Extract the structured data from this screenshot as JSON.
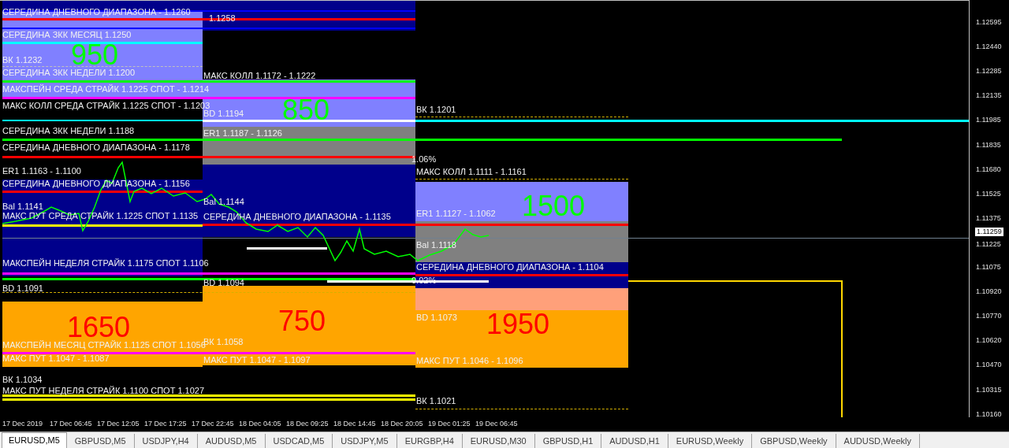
{
  "chart": {
    "labels": [
      {
        "text": "СЕРЕДИНА ДНЕВНОГО ДИАПАЗОНА - 1.1260"
      },
      {
        "text": "СЕРЕДИНА ЗКК МЕСЯЦ 1.1250"
      },
      {
        "text": "ВК 1.1232"
      },
      {
        "text": "СЕРЕДИНА ЗКК НЕДЕЛИ 1.1200"
      },
      {
        "text": "МАКСПЕЙН СРЕДА  СТРАЙК 1.1225 СПОТ - 1.1214"
      },
      {
        "text": "МАКС КОЛЛ СРЕДА  СТРАЙК 1.1225 СПОТ - 1.1203"
      },
      {
        "text": "СЕРЕДИНА ЗКК НЕДЕЛИ 1.1188"
      },
      {
        "text": "СЕРЕДИНА ДНЕВНОГО ДИАПАЗОНА - 1.1178"
      },
      {
        "text": "ER1 1.1163 - 1.1100"
      },
      {
        "text": "СЕРЕДИНА ДНЕВНОГО ДИАПАЗОНА - 1.1156"
      },
      {
        "text": "Bal 1.1141"
      },
      {
        "text": "МАКС ПУТ СРЕДА  СТРАЙК 1.1225 СПОТ 1.1135"
      },
      {
        "text": "МАКСПЕЙН НЕДЕЛЯ  СТРАЙК 1.1175 СПОТ  1.1106"
      },
      {
        "text": "BD 1.1091"
      },
      {
        "text": "МАКСПЕЙН МЕСЯЦ  СТРАЙК 1.1125 СПОТ  1.1056"
      },
      {
        "text": "МАКС ПУТ 1.1047 - 1.1087"
      },
      {
        "text": "ВК 1.1034"
      },
      {
        "text": "МАКС ПУТ НЕДЕЛЯ СТРАЙК 1.1100 СПОТ 1.1027"
      },
      {
        "text": "1.1258"
      },
      {
        "text": "МАКС КОЛЛ 1.1172 - 1.1222"
      },
      {
        "text": "BD 1.1194"
      },
      {
        "text": "ER1 1.1187 - 1.1126"
      },
      {
        "text": "Bal 1.1144"
      },
      {
        "text": "СЕРЕДИНА ДНЕВНОГО ДИАПАЗОНА - 1.1135"
      },
      {
        "text": "BD 1.1094"
      },
      {
        "text": "ВК 1.1058"
      },
      {
        "text": "МАКС ПУТ 1.1047 - 1.1097"
      },
      {
        "text": "ВК 1.1201"
      },
      {
        "text": "1.06%"
      },
      {
        "text": "МАКС КОЛЛ 1.1111 - 1.1161"
      },
      {
        "text": "ER1 1.1127 - 1.1062"
      },
      {
        "text": "Bal 1.1118"
      },
      {
        "text": "СЕРЕДИНА ДНЕВНОГО ДИАПАЗОНА - 1.1104"
      },
      {
        "text": "0.02%"
      },
      {
        "text": "BD 1.1073"
      },
      {
        "text": "МАКС ПУТ 1.1046 - 1.1096"
      },
      {
        "text": "ВК 1.1021"
      }
    ],
    "big_numbers": [
      {
        "text": "950",
        "color": "#00ff00"
      },
      {
        "text": "850",
        "color": "#00ff00"
      },
      {
        "text": "1500",
        "color": "#00ff00"
      },
      {
        "text": "1650",
        "color": "#ff0000"
      },
      {
        "text": "750",
        "color": "#ff0000"
      },
      {
        "text": "1950",
        "color": "#ff0000"
      }
    ]
  },
  "price_axis": [
    "1.12595",
    "1.12440",
    "1.12285",
    "1.12135",
    "1.11985",
    "1.11835",
    "1.11680",
    "1.11525",
    "1.11375",
    "1.11225",
    "1.11075",
    "1.10920",
    "1.10770",
    "1.10620",
    "1.10470",
    "1.10315",
    "1.10160"
  ],
  "current_price": "1.11259",
  "time_axis": [
    "17 Dec 2019",
    "17 Dec 06:45",
    "17 Dec 12:05",
    "17 Dec 17:25",
    "17 Dec 22:45",
    "18 Dec 04:05",
    "18 Dec 09:25",
    "18 Dec 14:45",
    "18 Dec 20:05",
    "19 Dec 01:25",
    "19 Dec 06:45"
  ],
  "tabs": [
    {
      "label": "EURUSD,M5",
      "selected": true
    },
    {
      "label": "GBPUSD,M5",
      "selected": false
    },
    {
      "label": "USDJPY,H4",
      "selected": false
    },
    {
      "label": "AUDUSD,M5",
      "selected": false
    },
    {
      "label": "USDCAD,M5",
      "selected": false
    },
    {
      "label": "USDJPY,M5",
      "selected": false
    },
    {
      "label": "EURGBP,H4",
      "selected": false
    },
    {
      "label": "EURUSD,M30",
      "selected": false
    },
    {
      "label": "GBPUSD,H1",
      "selected": false
    },
    {
      "label": "AUDUSD,H1",
      "selected": false
    },
    {
      "label": "EURUSD,Weekly",
      "selected": false
    },
    {
      "label": "GBPUSD,Weekly",
      "selected": false
    },
    {
      "label": "AUDUSD,Weekly",
      "selected": false
    }
  ]
}
